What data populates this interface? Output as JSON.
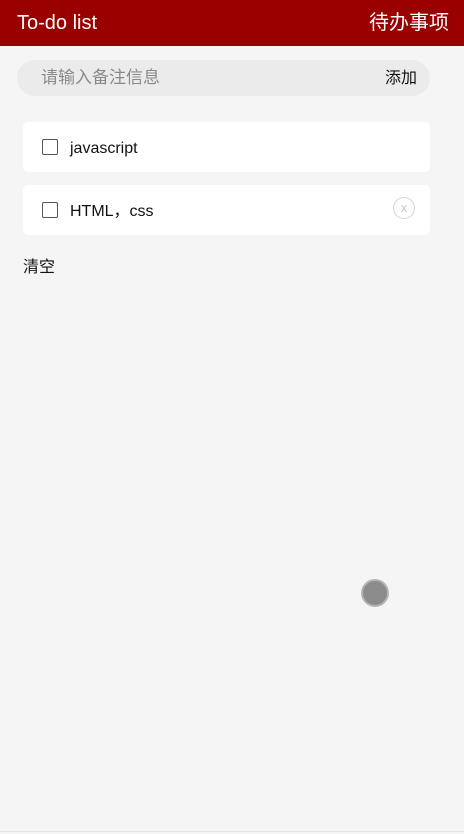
{
  "header": {
    "title": "To-do list",
    "subtitle": "待办事项"
  },
  "input": {
    "placeholder": "请输入备注信息",
    "value": "",
    "add_label": "添加"
  },
  "todos": [
    {
      "text": "javascript",
      "checked": false
    },
    {
      "text": "HTML，css",
      "checked": false,
      "delete_label": "x"
    }
  ],
  "clear_label": "清空",
  "colors": {
    "header_bg": "#990000",
    "header_text": "#ffffff",
    "page_bg": "#f5f5f5",
    "card_bg": "#ffffff",
    "input_bg": "#ebebeb"
  }
}
